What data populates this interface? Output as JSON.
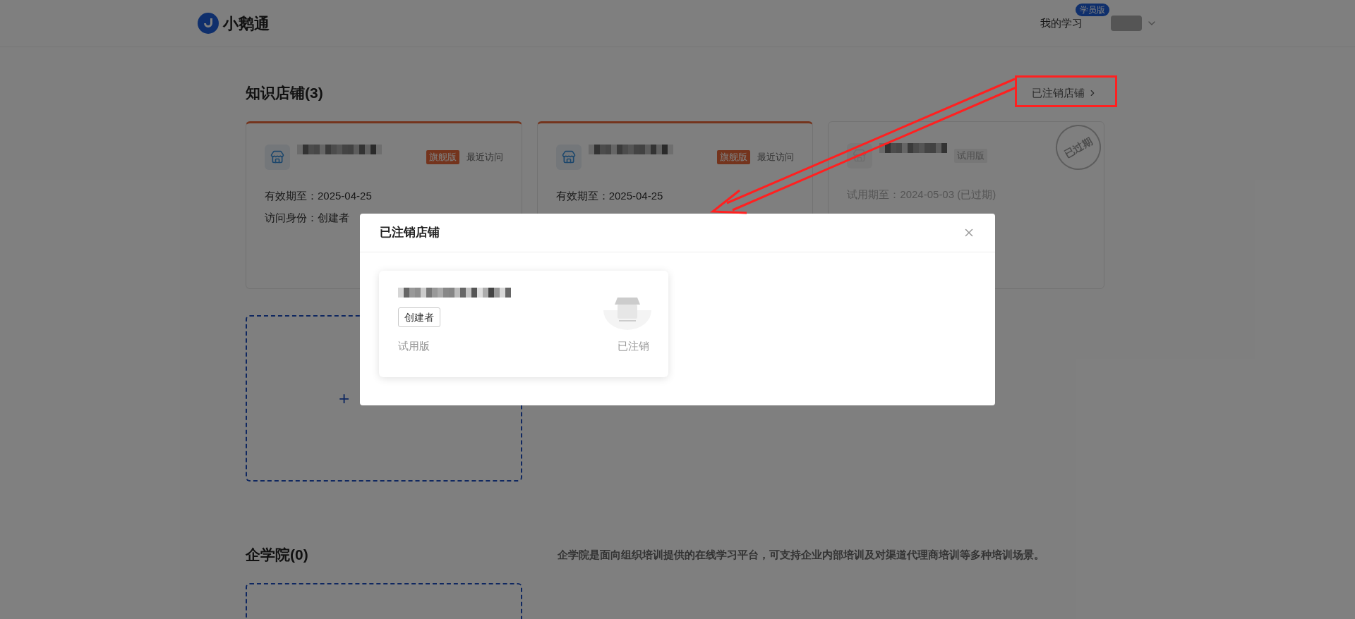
{
  "header": {
    "logo_text": "小鹅通",
    "nav_link": "我的学习",
    "nav_badge": "学员版"
  },
  "shops": {
    "title": "知识店铺(3)",
    "closed_link": "已注销店铺",
    "cards": [
      {
        "edition": "旗舰版",
        "kind": "flagship",
        "recent": "最近访问",
        "lines": [
          "有效期至：2025-04-25",
          "访问身份：创建者"
        ],
        "expired": false
      },
      {
        "edition": "旗舰版",
        "kind": "flagship",
        "recent": "最近访问",
        "lines": [
          "有效期至：2025-04-25"
        ],
        "expired": false
      },
      {
        "edition": "试用版",
        "kind": "trial",
        "lines": [
          "试用期至：2024-05-03 (已过期)"
        ],
        "expired": true,
        "stamp": "已过期"
      }
    ],
    "add_symbol": "+"
  },
  "academy": {
    "title": "企学院(0)",
    "description": "企学院是面向组织培训提供的在线学习平台，可支持企业内部培训及对渠道代理商培训等多种培训场景。"
  },
  "dialog": {
    "title": "已注销店铺",
    "items": [
      {
        "role": "创建者",
        "edition": "试用版",
        "status": "已注销"
      }
    ]
  }
}
